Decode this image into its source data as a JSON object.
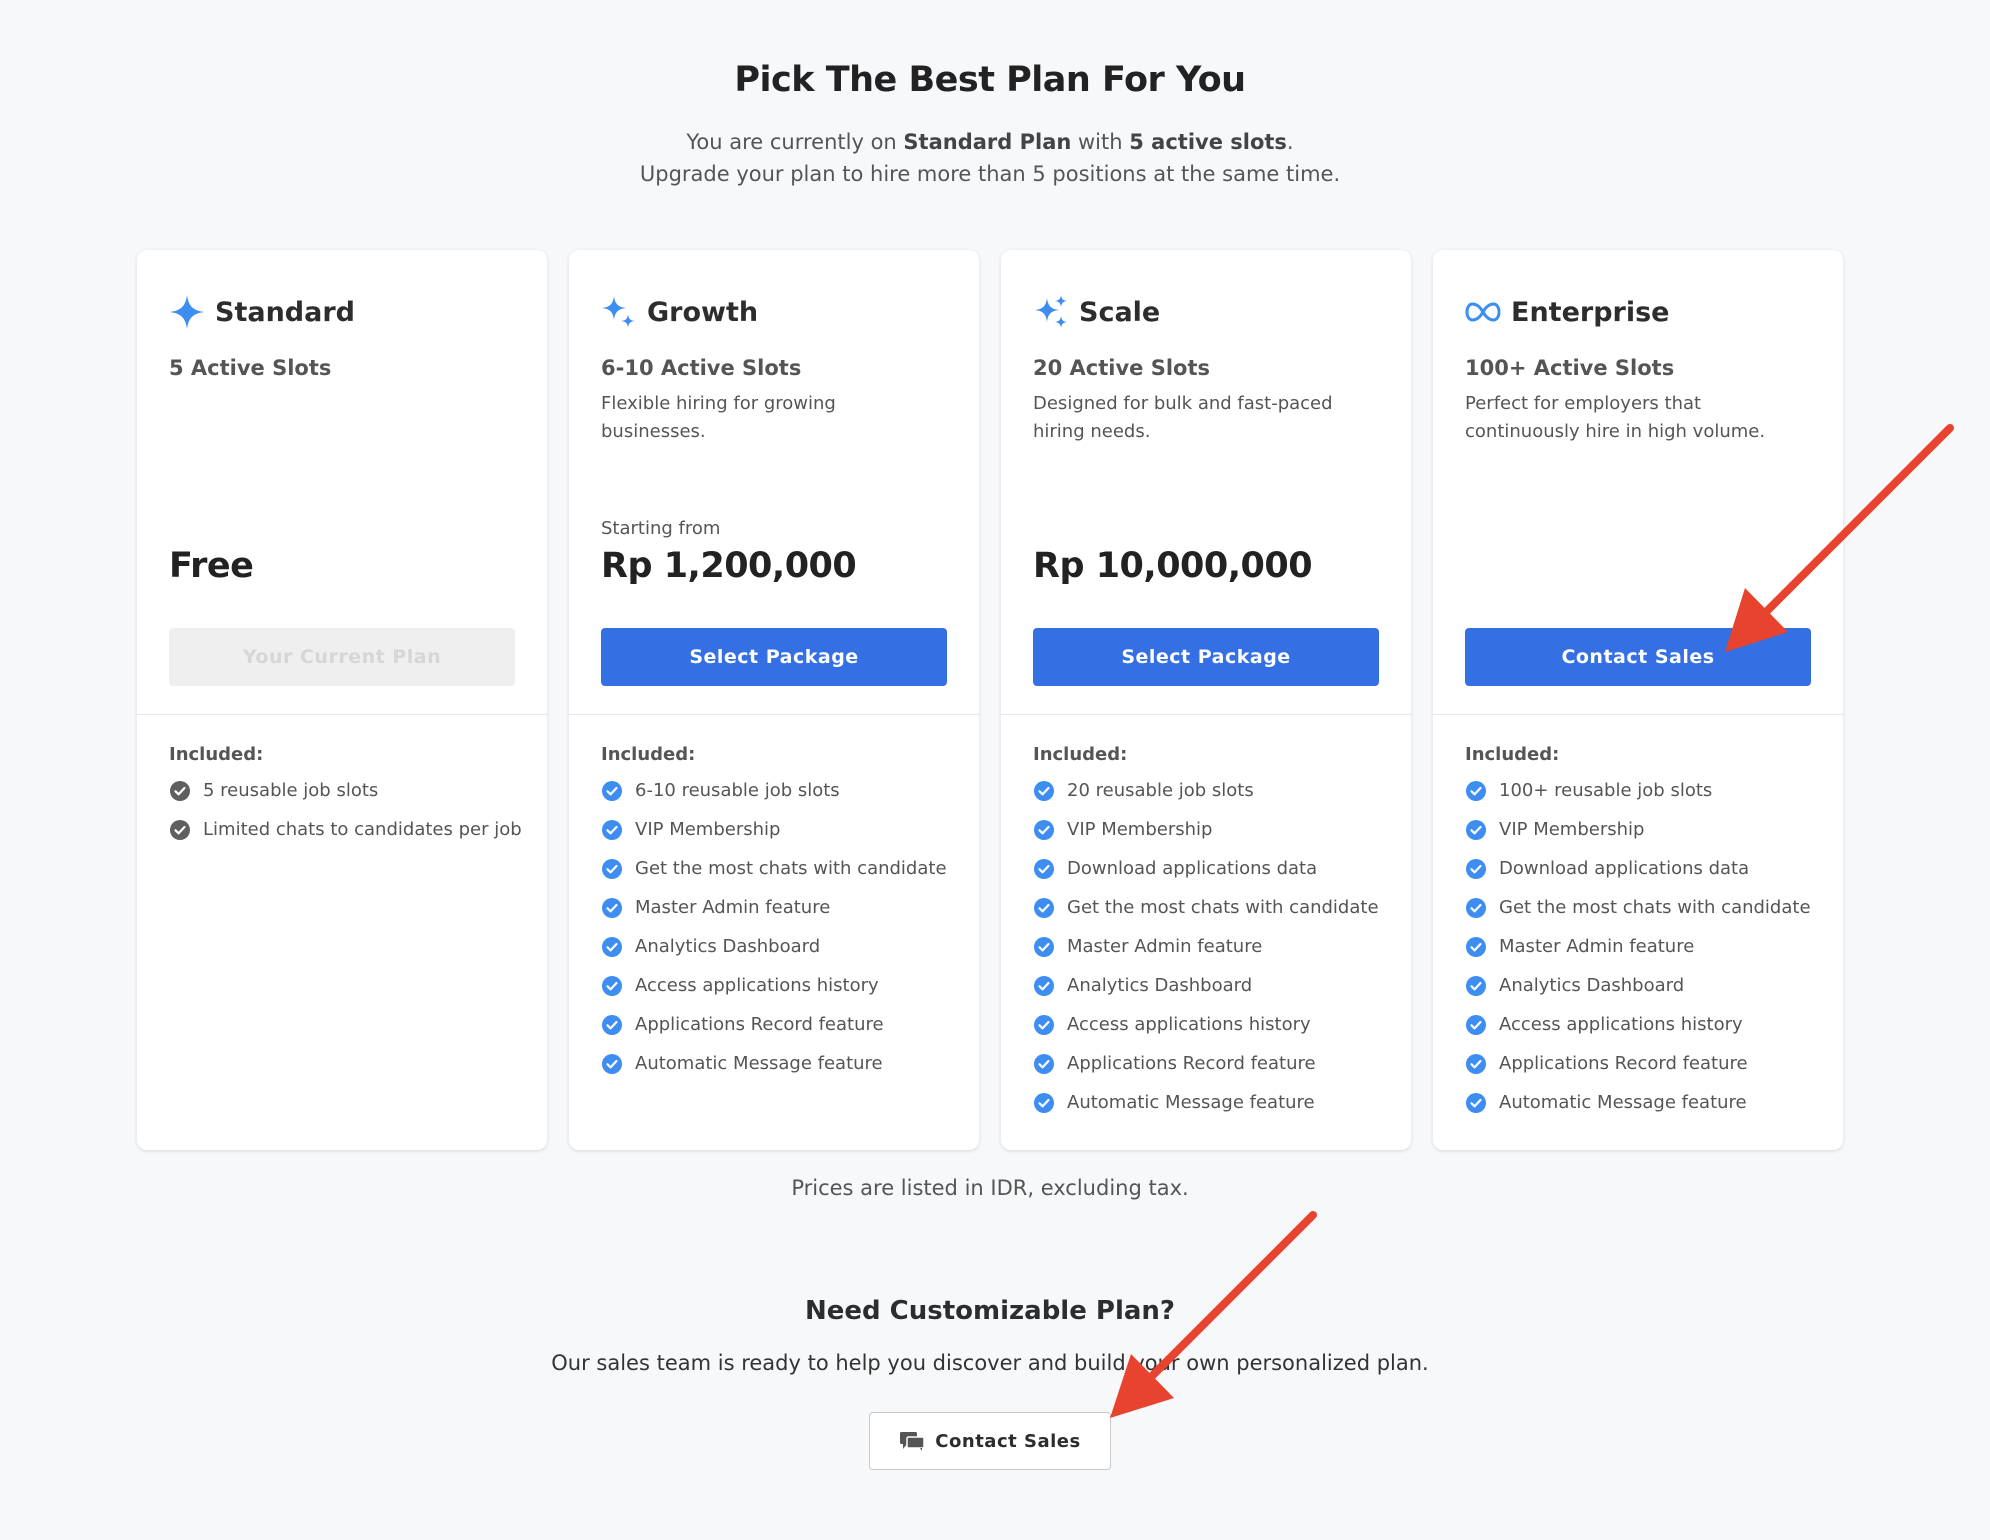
{
  "header": {
    "title": "Pick The Best Plan For You",
    "subtitle_prefix": "You are currently on ",
    "current_plan": "Standard Plan",
    "subtitle_mid": " with ",
    "active_slots": "5 active slots",
    "subtitle_end": ".",
    "subtitle_line2": "Upgrade your plan to hire more than 5 positions at the same time."
  },
  "plans": [
    {
      "name": "Standard",
      "icon": "sparkle-single-icon",
      "slots": "5 Active Slots",
      "description": "",
      "starting_label": "",
      "price": "Free",
      "button_label": "Your Current Plan",
      "button_disabled": true,
      "included_label": "Included:",
      "features": [
        "5 reusable job slots",
        "Limited chats to candidates per job"
      ],
      "check_color": "#5f5f5f"
    },
    {
      "name": "Growth",
      "icon": "sparkle-double-icon",
      "slots": "6-10 Active Slots",
      "description": "Flexible hiring for growing businesses.",
      "starting_label": "Starting from",
      "price": "Rp 1,200,000",
      "button_label": "Select Package",
      "button_disabled": false,
      "included_label": "Included:",
      "features": [
        "6-10 reusable job slots",
        "VIP Membership",
        "Get the most chats with candidate",
        "Master Admin feature",
        "Analytics Dashboard",
        "Access applications history",
        "Applications Record feature",
        "Automatic Message feature"
      ],
      "check_color": "#3d8ef0"
    },
    {
      "name": "Scale",
      "icon": "sparkle-triple-icon",
      "slots": "20 Active Slots",
      "description": "Designed for bulk and fast-paced hiring needs.",
      "starting_label": "",
      "price": "Rp 10,000,000",
      "button_label": "Select Package",
      "button_disabled": false,
      "included_label": "Included:",
      "features": [
        "20 reusable job slots",
        "VIP Membership",
        "Download applications data",
        "Get the most chats with candidate",
        "Master Admin feature",
        "Analytics Dashboard",
        "Access applications history",
        "Applications Record feature",
        "Automatic Message feature"
      ],
      "check_color": "#3d8ef0"
    },
    {
      "name": "Enterprise",
      "icon": "infinity-icon",
      "slots": "100+ Active Slots",
      "description": "Perfect for employers that continuously hire in high volume.",
      "starting_label": "",
      "price": "",
      "button_label": "Contact Sales",
      "button_disabled": false,
      "included_label": "Included:",
      "features": [
        "100+ reusable job slots",
        "VIP Membership",
        "Download applications data",
        "Get the most chats with candidate",
        "Master Admin feature",
        "Analytics Dashboard",
        "Access applications history",
        "Applications Record feature",
        "Automatic Message feature"
      ],
      "check_color": "#3d8ef0"
    }
  ],
  "note": "Prices are listed in IDR, excluding tax.",
  "custom": {
    "title": "Need Customizable Plan?",
    "description": "Our sales team is ready to help you discover and build your own personalized plan.",
    "button_label": "Contact Sales",
    "button_icon": "chat-bubble-icon"
  },
  "colors": {
    "primary": "#3470e4",
    "icon_blue": "#3d8ef0",
    "disabled_bg": "#efefef",
    "annotation_arrow": "#e8432e"
  }
}
